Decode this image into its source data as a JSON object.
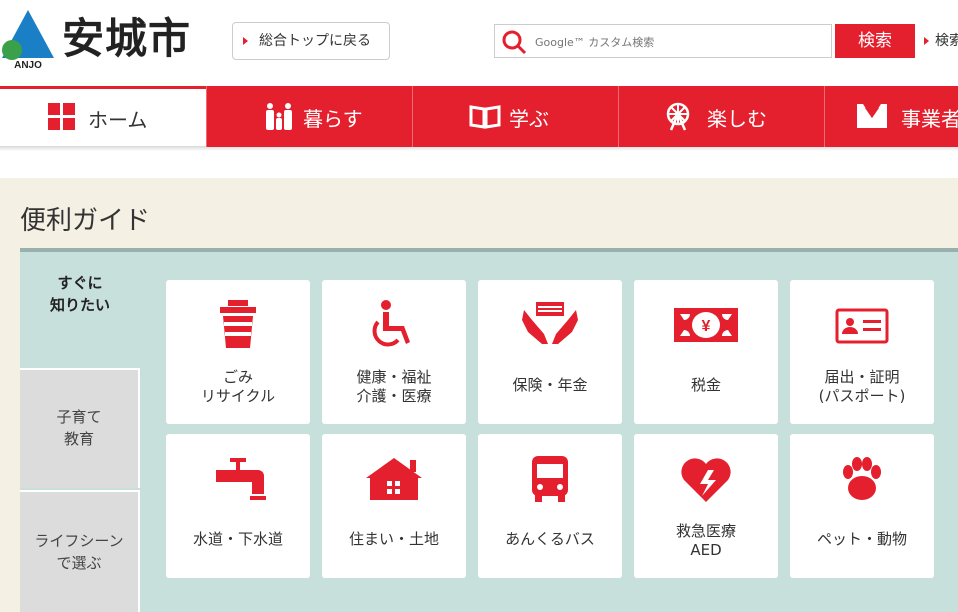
{
  "header": {
    "site_title": "安城市",
    "logo_text": "ANJO",
    "top_link": "総合トップに戻る",
    "search_placeholder": "Google™ カスタム検索",
    "search_button": "検索",
    "search_extra": "検索"
  },
  "nav": {
    "items": [
      {
        "label": "ホーム",
        "icon": "grid-icon"
      },
      {
        "label": "暮らす",
        "icon": "family-icon"
      },
      {
        "label": "学ぶ",
        "icon": "book-icon"
      },
      {
        "label": "楽しむ",
        "icon": "ferris-wheel-icon"
      },
      {
        "label": "事業者",
        "icon": "business-icon"
      }
    ]
  },
  "guide": {
    "title": "便利ガイド",
    "tabs": [
      {
        "label": "すぐに\n知りたい"
      },
      {
        "label": "子育て\n教育"
      },
      {
        "label": "ライフシーン\nで選ぶ"
      }
    ],
    "cards": [
      {
        "label": "ごみ\nリサイクル",
        "icon": "trash-can-icon"
      },
      {
        "label": "健康・福祉\n介護・医療",
        "icon": "wheelchair-icon"
      },
      {
        "label": "保険・年金",
        "icon": "hands-money-icon"
      },
      {
        "label": "税金",
        "icon": "yen-bill-icon"
      },
      {
        "label": "届出・証明\n(パスポート)",
        "icon": "id-card-icon"
      },
      {
        "label": "水道・下水道",
        "icon": "faucet-icon"
      },
      {
        "label": "住まい・土地",
        "icon": "house-icon"
      },
      {
        "label": "あんくるバス",
        "icon": "bus-icon"
      },
      {
        "label": "救急医療\nAED",
        "icon": "aed-heart-icon"
      },
      {
        "label": "ペット・動物",
        "icon": "paw-icon"
      }
    ]
  },
  "colors": {
    "accent": "#e4202e",
    "panel": "#c8e0dc",
    "guide_bg": "#f5f0e4"
  }
}
